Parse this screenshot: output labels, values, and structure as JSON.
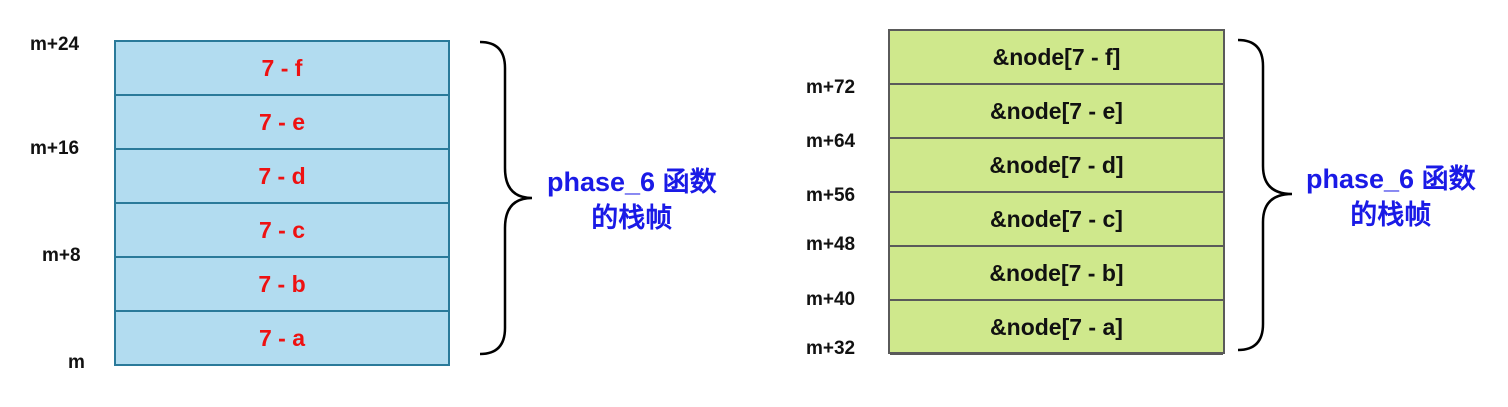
{
  "left_frame": {
    "cells": [
      "7 - f",
      "7 - e",
      "7 - d",
      "7 - c",
      "7 - b",
      "7 - a"
    ],
    "addresses": [
      "m+24",
      "m+16",
      "m+8",
      "m"
    ],
    "label_line1": "phase_6 函数",
    "label_line2": "的栈帧",
    "fill_color": "#b2dcf0",
    "text_color": "#ee1111"
  },
  "right_frame": {
    "cells": [
      "&node[7 - f]",
      "&node[7 - e]",
      "&node[7 - d]",
      "&node[7 - c]",
      "&node[7 - b]",
      "&node[7 - a]"
    ],
    "addresses": [
      "m+72",
      "m+64",
      "m+56",
      "m+48",
      "m+40",
      "m+32"
    ],
    "label_line1": "phase_6 函数",
    "label_line2": "的栈帧",
    "fill_color": "#cfe88c",
    "text_color": "#111111"
  },
  "label_color": "#1a1ae6"
}
